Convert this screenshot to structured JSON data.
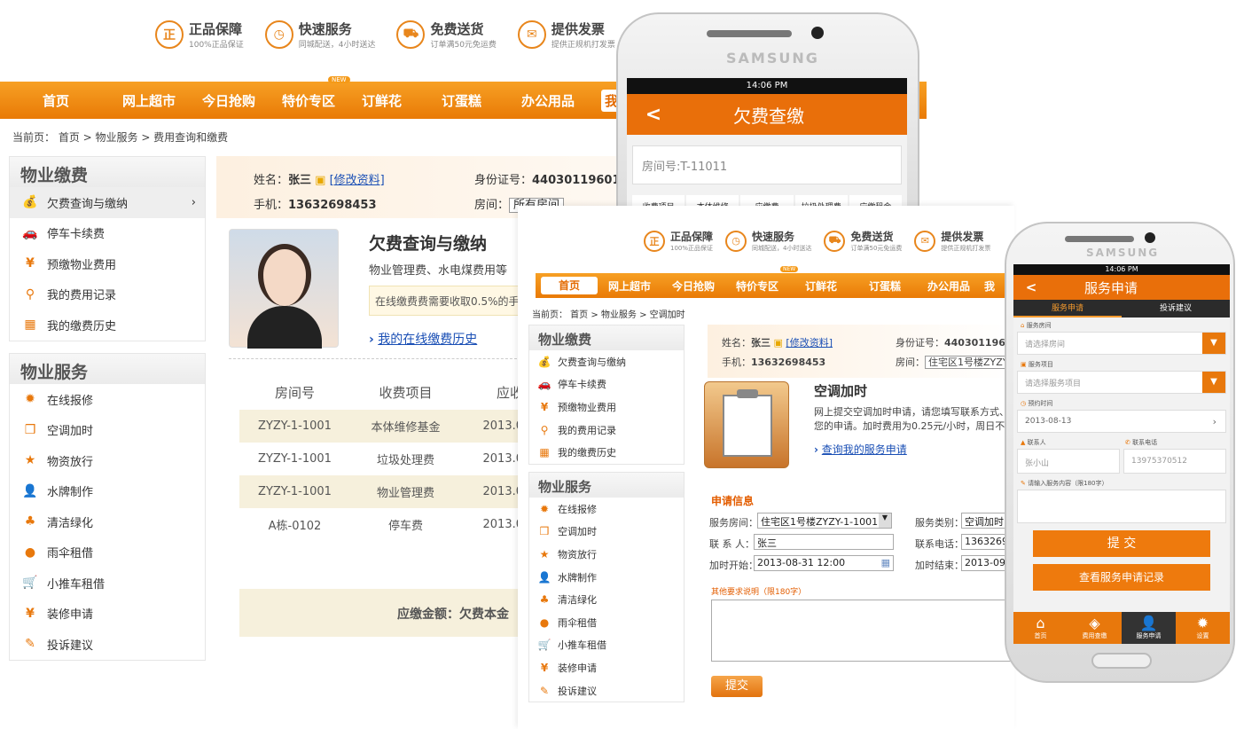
{
  "badges": [
    {
      "title": "正品保障",
      "sub": "100%正品保证",
      "icon": "正"
    },
    {
      "title": "快速服务",
      "sub": "同城配送，4小时送达",
      "icon": "◷"
    },
    {
      "title": "免费送货",
      "sub": "订单满50元免运费",
      "icon": "⛟"
    },
    {
      "title": "提供发票",
      "sub": "提供正规机打发票",
      "icon": "✉"
    }
  ],
  "nav1": [
    "首页",
    "网上超市",
    "今日抢购",
    "特价专区",
    "订鲜花",
    "订蛋糕",
    "办公用品",
    "我的"
  ],
  "nav_new": "NEW",
  "crumb1": "当前页： 首页 > 物业服务 > 费用查询和缴费",
  "sidebar": {
    "pay_title": "物业缴费",
    "pay_items": [
      "欠费查询与缴纳",
      "停车卡续费",
      "预缴物业费用",
      "我的费用记录",
      "我的缴费历史"
    ],
    "service_title": "物业服务",
    "service_items": [
      "在线报修",
      "空调加时",
      "物资放行",
      "水牌制作",
      "清洁绿化",
      "雨伞租借",
      "小推车租借",
      "装修申请",
      "投诉建议"
    ]
  },
  "profile": {
    "name_label": "姓名：",
    "name": "张三",
    "edit": "[修改资料]",
    "phone_label": "手机：",
    "phone": "13632698453",
    "id_label": "身份证号：",
    "id1": "44030119601",
    "id2": "4403011960",
    "room_label": "房间：",
    "room1": "所有房间",
    "room2": "住宅区1号楼ZYZY"
  },
  "main1": {
    "title": "欠费查询与缴纳",
    "desc": "物业管理费、水电煤费用等",
    "notice": "在线缴费费需要收取0.5%的手",
    "history_link": "我的在线缴费历史",
    "col1": "房间号",
    "col2": "收费项目",
    "col3": "应收",
    "rows": [
      [
        "ZYZY-1-1001",
        "本体维修基金",
        "2013.0"
      ],
      [
        "ZYZY-1-1001",
        "垃圾处理费",
        "2013.0"
      ],
      [
        "ZYZY-1-1001",
        "物业管理费",
        "2013.0"
      ],
      [
        "A栋-0102",
        "停车费",
        "2013.0"
      ]
    ],
    "total": "应缴金额：欠费本金"
  },
  "phone1": {
    "brand": "SAMSUNG",
    "time": "14:06 PM",
    "title": "欠费查缴",
    "back": "<",
    "room": "房间号:T-11011",
    "tabs": [
      "收费项目",
      "本体维修",
      "应缴费",
      "垃圾处理费",
      "应缴租金"
    ]
  },
  "nav2": [
    "首页",
    "网上超市",
    "今日抢购",
    "特价专区",
    "订鲜花",
    "订蛋糕",
    "办公用品",
    "我"
  ],
  "crumb2": "当前页： 首页 > 物业服务 > 空调加时",
  "main2": {
    "title": "空调加时",
    "desc1": "网上提交空调加时申请，请您填写联系方式、",
    "desc2": "您的申请。加时费用为0.25元/小时，周日不",
    "link": "查询我的服务申请",
    "form_title": "申请信息",
    "room_label": "服务房间：",
    "room": "住宅区1号楼ZYZY-1-1001",
    "type_label": "服务类别：",
    "type": "空调加时",
    "contact_label": "联 系 人：",
    "contact": "张三",
    "tel_label": "联系电话：",
    "tel": "13632698",
    "start_label": "加时开始：",
    "start": "2013-08-31 12:00",
    "end_label": "加时结束：",
    "end": "2013-09-0",
    "other": "其他要求说明（限180字）",
    "submit": "提交"
  },
  "phone2": {
    "brand": "SAMSUNG",
    "time": "14:06 PM",
    "title": "服务申请",
    "back": "<",
    "tab1": "服务申请",
    "tab2": "投诉建议",
    "room_label": "服务房间",
    "room_ph": "请选择房间",
    "item_label": "服务项目",
    "item_ph": "请选择服务项目",
    "date_label": "预约时间",
    "date": "2013-08-13",
    "contact_label": "联系人",
    "contact": "张小山",
    "tel_label": "联系电话",
    "tel": "13975370512",
    "content_label": "请输入服务内容（限180字）",
    "submit": "提 交",
    "records": "查看服务申请记录",
    "bottom": [
      "首页",
      "费用查缴",
      "服务申请",
      "设置"
    ]
  }
}
